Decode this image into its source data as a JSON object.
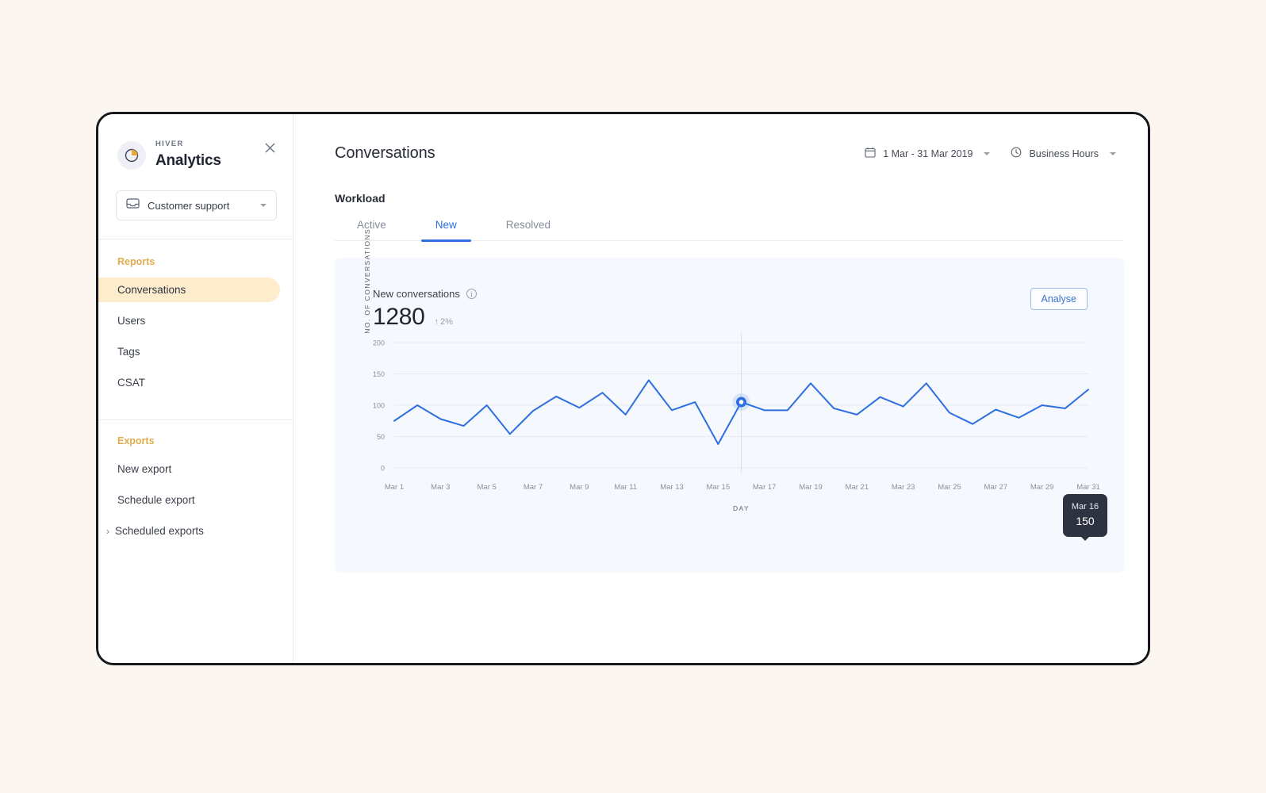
{
  "sidebar": {
    "brand": {
      "eyebrow": "HIVER",
      "title": "Analytics"
    },
    "close_label": "✕",
    "inbox": {
      "label": "Customer support",
      "icon": "inbox-icon"
    },
    "reports": {
      "heading": "Reports",
      "items": [
        {
          "label": "Conversations",
          "active": true
        },
        {
          "label": "Users",
          "active": false
        },
        {
          "label": "Tags",
          "active": false
        },
        {
          "label": "CSAT",
          "active": false
        }
      ]
    },
    "exports": {
      "heading": "Exports",
      "items": [
        {
          "label": "New export",
          "chevron": false
        },
        {
          "label": "Schedule export",
          "chevron": false
        },
        {
          "label": "Scheduled exports",
          "chevron": true
        }
      ],
      "chevron_glyph": "›"
    }
  },
  "header": {
    "title": "Conversations",
    "filters": [
      {
        "icon": "calendar-icon",
        "label": "1 Mar - 31 Mar 2019"
      },
      {
        "icon": "clock-icon",
        "label": "Business Hours"
      }
    ]
  },
  "workload": {
    "section_title": "Workload",
    "tabs": [
      {
        "label": "Active",
        "active": false
      },
      {
        "label": "New",
        "active": true
      },
      {
        "label": "Resolved",
        "active": false
      }
    ]
  },
  "chart_card": {
    "metric_label": "New conversations",
    "info_glyph": "i",
    "metric_value": "1280",
    "delta_arrow": "↑",
    "delta_value": "2%",
    "analyse_label": "Analyse",
    "tooltip": {
      "date": "Mar 16",
      "value": "150"
    },
    "accent_color": "#2d6fe0",
    "card_background": "#f5f8fd"
  },
  "chart_data": {
    "type": "line",
    "title": "New conversations",
    "xlabel": "DAY",
    "ylabel": "NO. OF CONVERSATIONS",
    "ylim": [
      0,
      200
    ],
    "yticks": [
      0,
      50,
      100,
      150,
      200
    ],
    "ytick_labels": [
      "0",
      "50",
      "100",
      "150",
      "200"
    ],
    "xticks": [
      "Mar 1",
      "Mar 3",
      "Mar 5",
      "Mar 7",
      "Mar 9",
      "Mar 11",
      "Mar 13",
      "Mar 15",
      "Mar 17",
      "Mar 19",
      "Mar 21",
      "Mar 23",
      "Mar 25",
      "Mar 27",
      "Mar 29",
      "Mar 31"
    ],
    "grid": true,
    "legend": "none",
    "line_color": "#2d6fe0",
    "x": [
      "Mar 1",
      "Mar 2",
      "Mar 3",
      "Mar 4",
      "Mar 5",
      "Mar 6",
      "Mar 7",
      "Mar 8",
      "Mar 9",
      "Mar 10",
      "Mar 11",
      "Mar 12",
      "Mar 13",
      "Mar 14",
      "Mar 15",
      "Mar 16",
      "Mar 17",
      "Mar 18",
      "Mar 19",
      "Mar 20",
      "Mar 21",
      "Mar 22",
      "Mar 23",
      "Mar 24",
      "Mar 25",
      "Mar 26",
      "Mar 27",
      "Mar 28",
      "Mar 29",
      "Mar 30",
      "Mar 31"
    ],
    "values": [
      75,
      100,
      78,
      67,
      100,
      54,
      91,
      114,
      96,
      120,
      85,
      140,
      92,
      105,
      38,
      105,
      92,
      92,
      135,
      95,
      85,
      113,
      98,
      135,
      88,
      70,
      93,
      80,
      100,
      95,
      125
    ],
    "highlight": {
      "x": "Mar 16",
      "value": 150,
      "marker": "circle"
    },
    "annotations": [
      {
        "type": "tooltip",
        "x": "Mar 16",
        "text_lines": [
          "Mar 16",
          "150"
        ]
      }
    ]
  }
}
